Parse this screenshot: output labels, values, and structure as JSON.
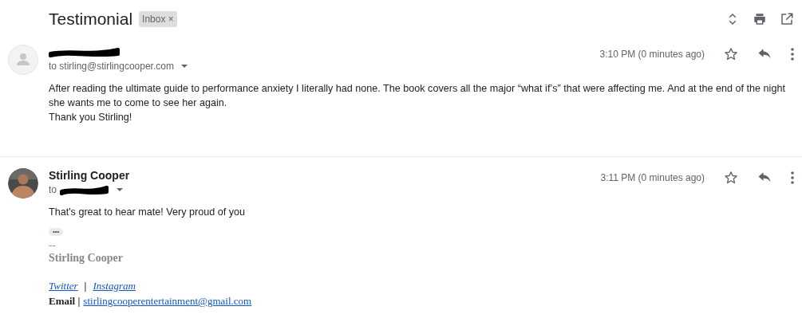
{
  "subject": "Testimonial",
  "label": {
    "text": "Inbox",
    "remove": "×"
  },
  "messages": [
    {
      "avatar": {
        "kind": "placeholder"
      },
      "sender": {
        "redacted": true
      },
      "recipient": {
        "text": "to stirling@stirlingcooper.com",
        "redacted": false
      },
      "time": "3:10 PM (0 minutes ago)",
      "starred": false,
      "body": [
        "After reading the ultimate guide to performance anxiety I literally had none. The book covers all the major “what if’s” that were affecting me. And at the end of the night she wants me to come to see her again.",
        "Thank you Stirling!"
      ]
    },
    {
      "avatar": {
        "kind": "picture"
      },
      "sender": {
        "name": "Stirling Cooper",
        "redacted": false
      },
      "recipient": {
        "text": "to",
        "redacted": true
      },
      "time": "3:11 PM (0 minutes ago)",
      "starred": false,
      "body": [
        "That's great to hear mate! Very proud of you"
      ],
      "trimmed": "•••",
      "signature": {
        "separator": "--",
        "name": "Stirling Cooper",
        "links": [
          "Twitter",
          "Instagram"
        ],
        "link_separator": "|",
        "email_label": "Email |",
        "email": "stirlingcooperentertainment@gmail.com"
      }
    }
  ]
}
